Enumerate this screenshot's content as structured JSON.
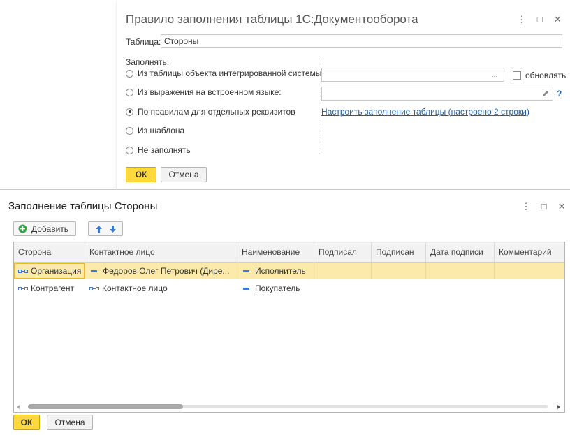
{
  "dialog1": {
    "title": "Правило заполнения таблицы 1С:Документооборота",
    "table_label": "Таблица:",
    "table_value": "Стороны",
    "fill_label": "Заполнять:",
    "options": [
      {
        "label": "Из таблицы объекта интегрированной системы:",
        "selected": false
      },
      {
        "label": "Из выражения на встроенном языке:",
        "selected": false
      },
      {
        "label": "По правилам для отдельных реквизитов",
        "selected": true
      },
      {
        "label": "Из шаблона",
        "selected": false
      },
      {
        "label": "Не заполнять",
        "selected": false
      }
    ],
    "source_table_value": "",
    "ellipsis": "...",
    "refresh_label": "обновлять",
    "expression_value": "",
    "help_icon": "?",
    "setup_link": "Настроить заполнение таблицы (настроено 2 строки)",
    "ok_label": "ОК",
    "cancel_label": "Отмена"
  },
  "form2": {
    "title": "Заполнение таблицы Стороны",
    "add_label": "Добавить",
    "columns": [
      "Сторона",
      "Контактное лицо",
      "Наименование",
      "Подписал",
      "Подписан",
      "Дата подписи",
      "Комментарий"
    ],
    "rows": [
      {
        "side": "Организация",
        "contact": "Федоров Олег Петрович (Дире...",
        "name": "Исполнитель",
        "signed_by": "",
        "signed": "",
        "sign_date": "",
        "comment": ""
      },
      {
        "side": "Контрагент",
        "contact": "Контактное лицо",
        "name": "Покупатель",
        "signed_by": "",
        "signed": "",
        "sign_date": "",
        "comment": ""
      }
    ],
    "ok_label": "ОК",
    "cancel_label": "Отмена"
  },
  "window_buttons": {
    "menu": "⋮",
    "maximize": "□",
    "close": "✕"
  },
  "colors": {
    "ok_button": "#ffd83e",
    "selected_row": "#fbeaaa",
    "link": "#1f5fa8",
    "add_icon": "#3aa34a",
    "arrow_icon": "#3a7bd5"
  }
}
